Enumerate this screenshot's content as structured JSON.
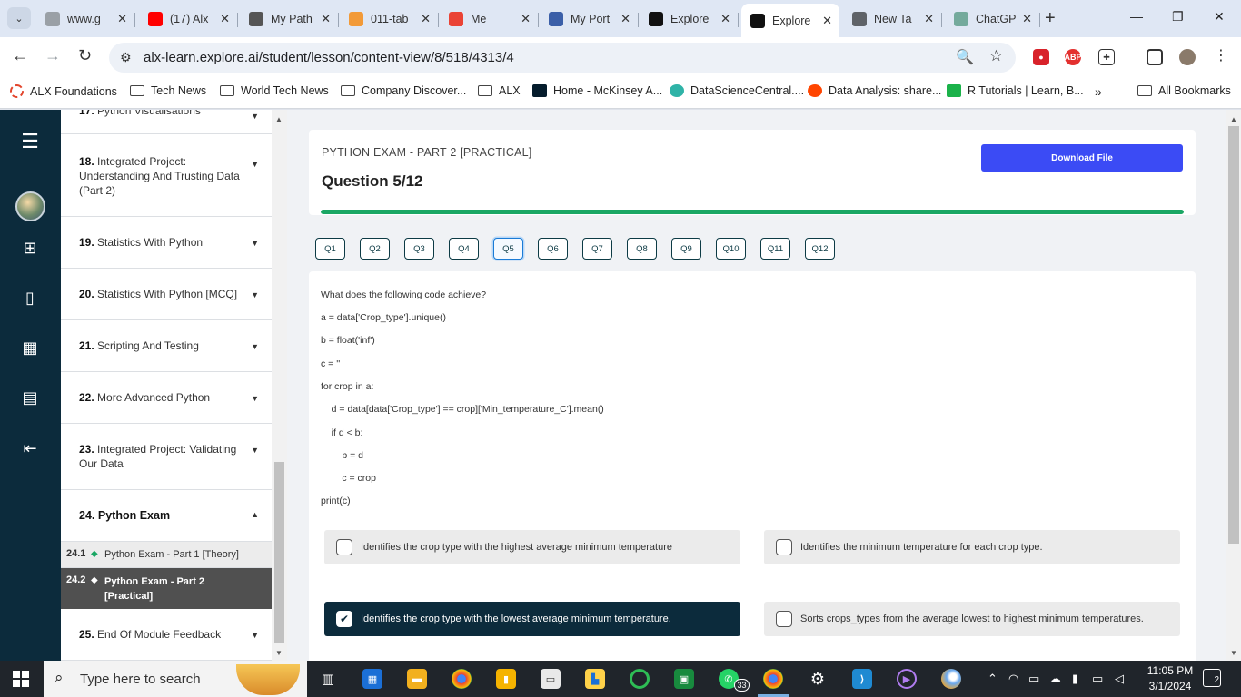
{
  "browser": {
    "tabs": [
      {
        "label": "www.g",
        "color": "#9aa0a6"
      },
      {
        "label": "(17) Alx",
        "color": "#ff0000"
      },
      {
        "label": "My Path",
        "color": "#555555"
      },
      {
        "label": "011-tab",
        "color": "#f29a38"
      },
      {
        "label": "Me",
        "color": "#ea4335"
      },
      {
        "label": "My Port",
        "color": "#3b5fa8"
      },
      {
        "label": "Explore",
        "color": "#111111"
      },
      {
        "label": "Explore",
        "color": "#111111"
      },
      {
        "label": "New Ta",
        "color": "#5f6368"
      },
      {
        "label": "ChatGP",
        "color": "#74aa9c"
      }
    ],
    "active_tab": 7,
    "url": "alx-learn.explore.ai/student/lesson/content-view/8/518/4313/4",
    "bookmarks": [
      "ALX Foundations",
      "Tech News",
      "World Tech News",
      "Company Discover...",
      "ALX",
      "Home - McKinsey A...",
      "DataScienceCentral....",
      "Data Analysis: share...",
      "R Tutorials | Learn, B...",
      "All Bookmarks"
    ]
  },
  "sidebar": {
    "modules": [
      {
        "num": "17.",
        "title": "Python Visualisations"
      },
      {
        "num": "18.",
        "title": "Integrated Project: Understanding And Trusting Data (Part 2)"
      },
      {
        "num": "19.",
        "title": "Statistics With Python"
      },
      {
        "num": "20.",
        "title": "Statistics With Python [MCQ]"
      },
      {
        "num": "21.",
        "title": "Scripting And Testing"
      },
      {
        "num": "22.",
        "title": "More Advanced Python"
      },
      {
        "num": "23.",
        "title": "Integrated Project: Validating Our Data"
      },
      {
        "num": "24.",
        "title": "Python Exam"
      },
      {
        "num": "25.",
        "title": "End Of Module Feedback"
      }
    ],
    "sublessons": [
      {
        "num": "24.1",
        "title": "Python Exam - Part 1 [Theory]"
      },
      {
        "num": "24.2",
        "title": "Python Exam - Part 2 [Practical]"
      }
    ]
  },
  "exam": {
    "title": "PYTHON EXAM - PART 2 [PRACTICAL]",
    "question_counter": "Question 5/12",
    "download_label": "Download File",
    "progress": 1.0,
    "question_buttons": [
      "Q1",
      "Q2",
      "Q3",
      "Q4",
      "Q5",
      "Q6",
      "Q7",
      "Q8",
      "Q9",
      "Q10",
      "Q11",
      "Q12"
    ],
    "active_question": 4,
    "prompt": "What does the following code achieve?",
    "code_lines": [
      "a = data['Crop_type'].unique()",
      "b = float('inf')",
      "c = ''",
      "for crop in a:",
      "    d = data[data['Crop_type'] == crop]['Min_temperature_C'].mean()",
      "    if d < b:",
      "        b = d",
      "        c = crop",
      "print(c)"
    ],
    "options": [
      {
        "text": "Identifies the crop type with the highest average minimum temperature",
        "checked": false
      },
      {
        "text": "Identifies the minimum temperature for each crop type.",
        "checked": false
      },
      {
        "text": "Identifies the crop type with the lowest average minimum temperature.",
        "checked": true
      },
      {
        "text": "Sorts crops_types from the average lowest to highest minimum temperatures.",
        "checked": false
      }
    ]
  },
  "taskbar": {
    "search_placeholder": "Type here to search",
    "whatsapp_badge": "33",
    "time": "11:05 PM",
    "date": "3/1/2024",
    "notification_count": "2"
  }
}
